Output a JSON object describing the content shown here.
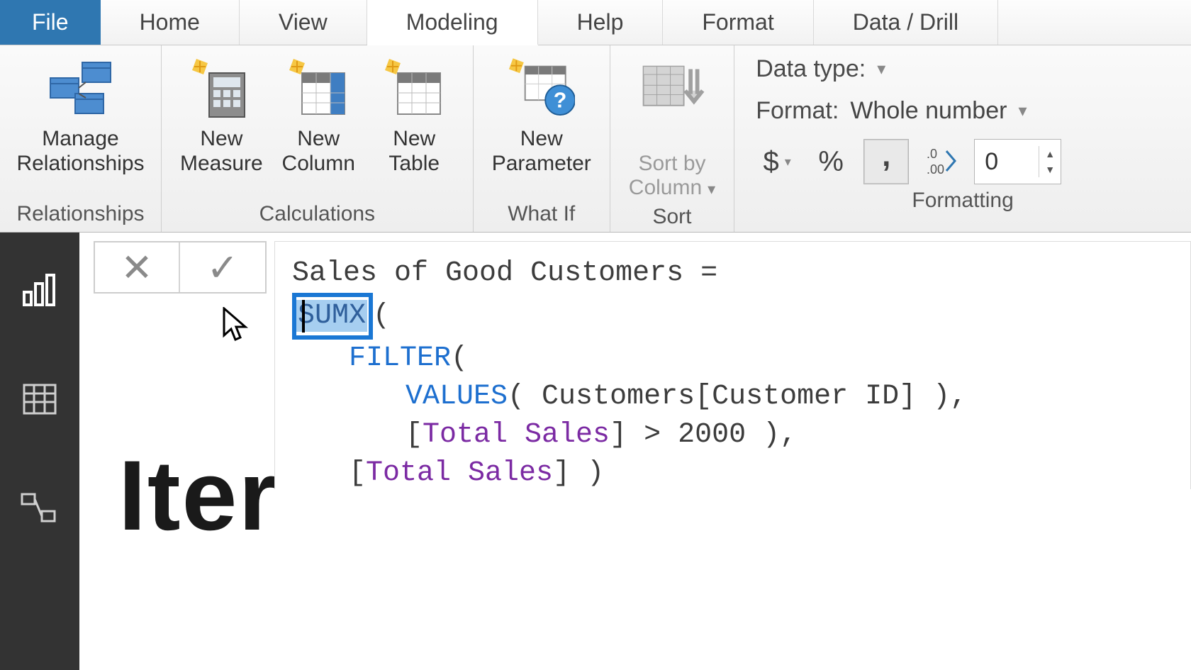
{
  "tabs": {
    "file": "File",
    "home": "Home",
    "view": "View",
    "modeling": "Modeling",
    "help": "Help",
    "format": "Format",
    "data_drill": "Data / Drill"
  },
  "ribbon": {
    "relationships": {
      "manage_label": "Manage\nRelationships",
      "group_title": "Relationships"
    },
    "calculations": {
      "new_measure": "New\nMeasure",
      "new_column": "New\nColumn",
      "new_table": "New\nTable",
      "group_title": "Calculations"
    },
    "whatif": {
      "new_parameter": "New\nParameter",
      "group_title": "What If"
    },
    "sort": {
      "sort_by_column": "Sort by\nColumn",
      "group_title": "Sort"
    },
    "formatting": {
      "data_type_label": "Data type:",
      "format_label": "Format:",
      "format_value": "Whole number",
      "currency_symbol": "$",
      "percent_symbol": "%",
      "thousands_sep": ",",
      "decimals_value": "0",
      "group_title": "Formatting"
    }
  },
  "formula": {
    "measure_name": "Sales of Good Customers",
    "eq": "=",
    "sumx": "SUMX",
    "sumx_paren": "(",
    "filter": "FILTER",
    "filter_open": "(",
    "values": "VALUES",
    "values_open": "(",
    "values_arg": " Customers[Customer ID] )",
    "values_comma": ",",
    "bracket_open": "[",
    "total_sales": "Total Sales",
    "bracket_close": "]",
    "gt": ">",
    "threshold": "2000",
    "filter_close": ")",
    "comma": ",",
    "final_open": "[",
    "final_measure": "Total Sales",
    "final_close_bracket": "]",
    "final_close_paren": ")"
  },
  "canvas_title": "Iter"
}
